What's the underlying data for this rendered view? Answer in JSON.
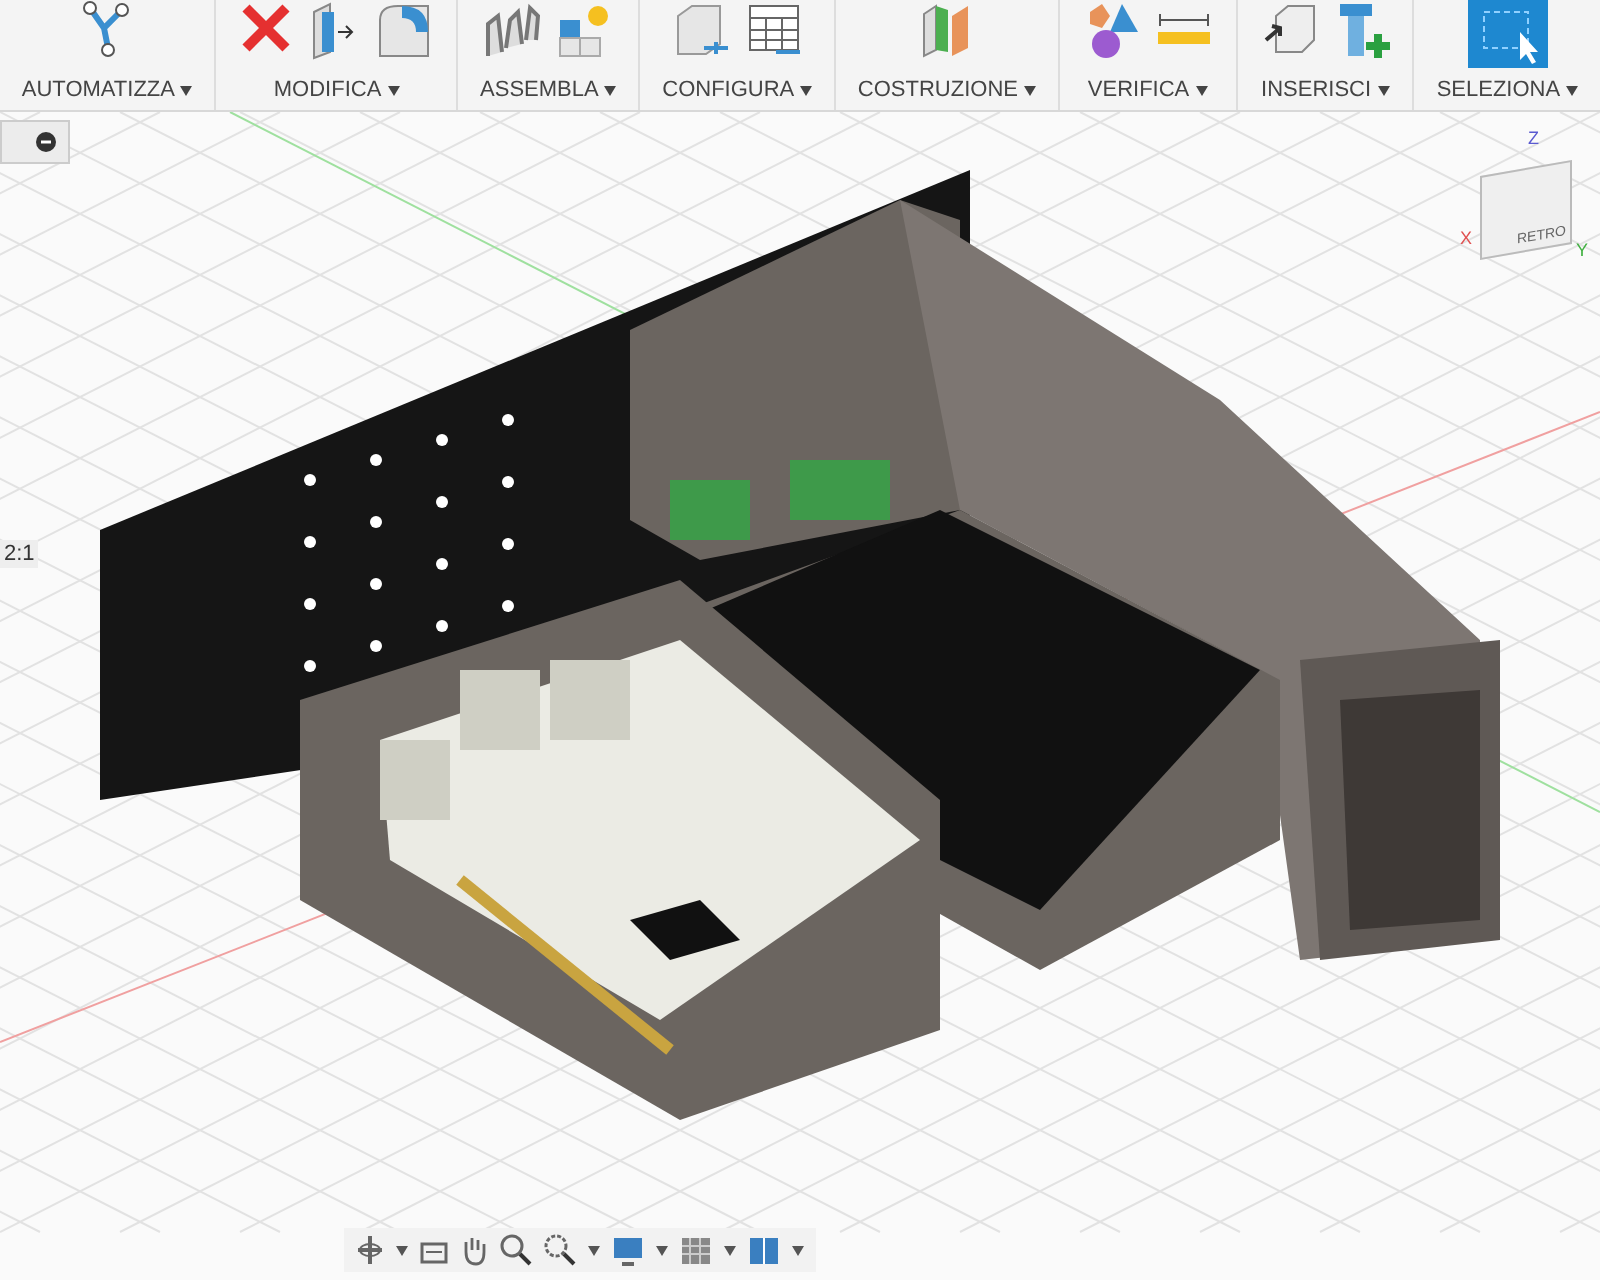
{
  "toolbar": {
    "groups": [
      {
        "label": "AUTOMATIZZA"
      },
      {
        "label": "MODIFICA"
      },
      {
        "label": "ASSEMBLA"
      },
      {
        "label": "CONFIGURA"
      },
      {
        "label": "COSTRUZIONE"
      },
      {
        "label": "VERIFICA"
      },
      {
        "label": "INSERISCI"
      },
      {
        "label": "SELEZIONA"
      }
    ]
  },
  "viewport": {
    "scale_label": "2:1",
    "view_cube": {
      "face_label": "RETRO",
      "axes": [
        "Z",
        "X",
        "Y"
      ]
    }
  }
}
